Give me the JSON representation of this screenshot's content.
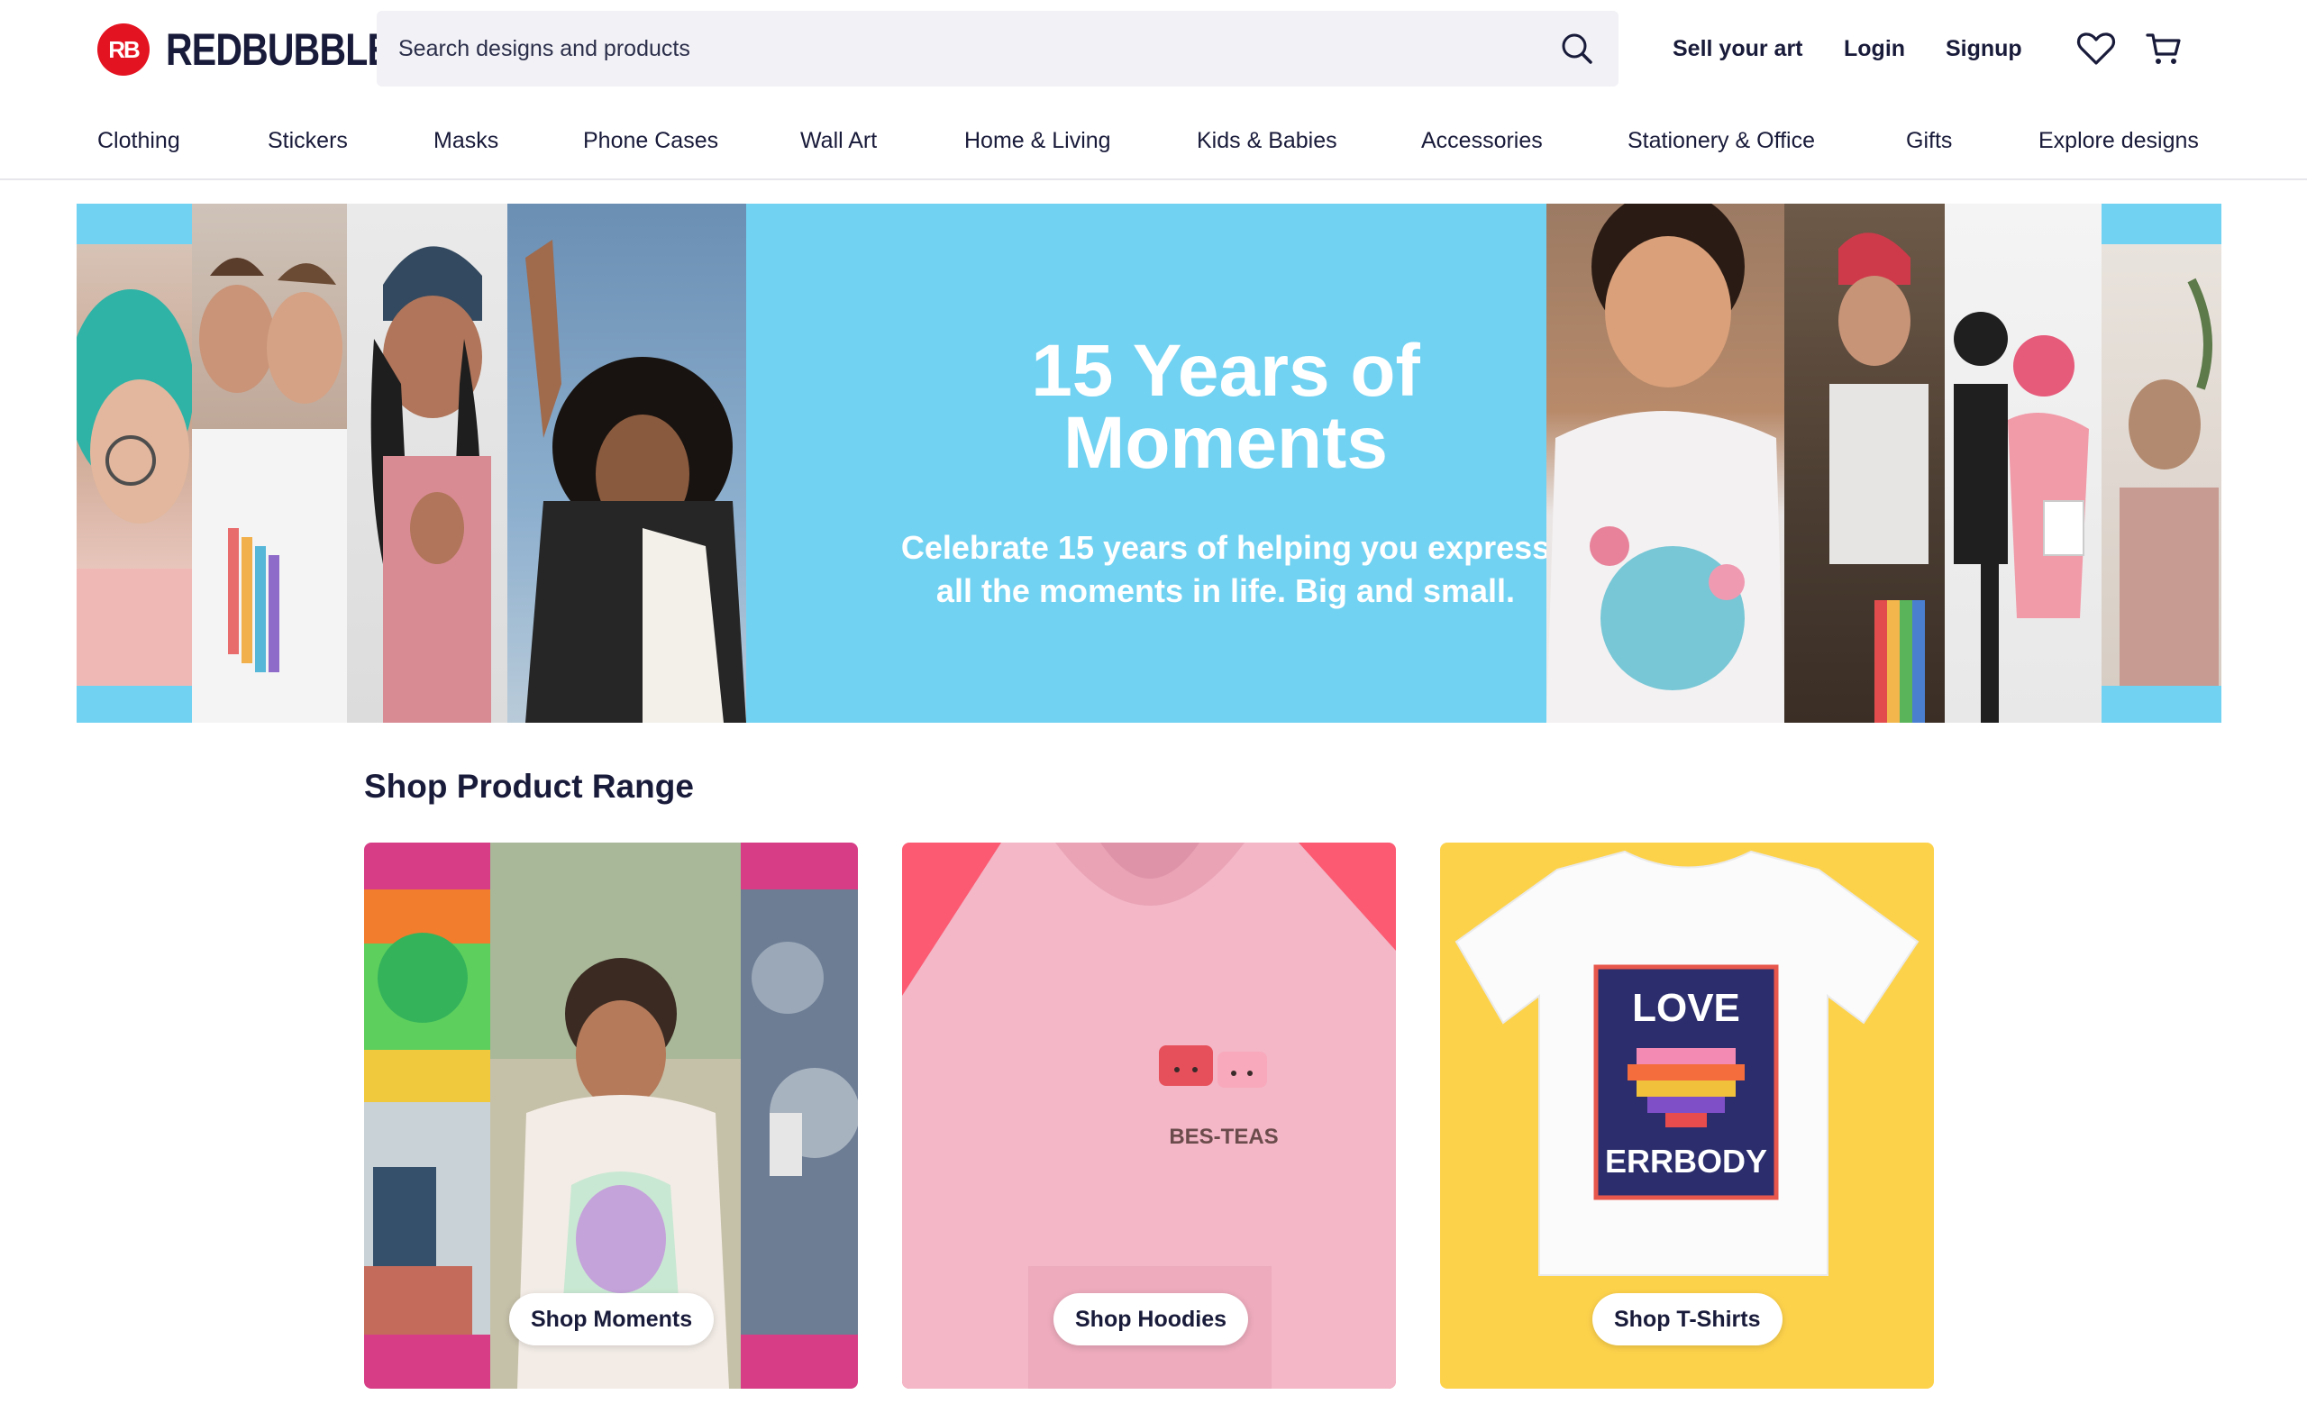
{
  "brand": {
    "name": "REDBUBBLE",
    "mark": "RB",
    "color": "#e41321"
  },
  "search": {
    "placeholder": "Search designs and products",
    "icon": "search-icon"
  },
  "header_links": {
    "sell": "Sell your art",
    "login": "Login",
    "signup": "Signup"
  },
  "header_icons": [
    "heart-icon",
    "cart-icon"
  ],
  "nav": [
    "Clothing",
    "Stickers",
    "Masks",
    "Phone Cases",
    "Wall Art",
    "Home & Living",
    "Kids & Babies",
    "Accessories",
    "Stationery & Office",
    "Gifts",
    "Explore designs"
  ],
  "hero": {
    "title_line1": "15 Years of",
    "title_line2": "Moments",
    "subtitle_line1": "Celebrate 15 years of helping you express",
    "subtitle_line2": "all the moments in life. Big and small.",
    "background": "#72d2f2"
  },
  "section": {
    "title": "Shop Product Range"
  },
  "cards": [
    {
      "button": "Shop Moments",
      "background": "#d63d86"
    },
    {
      "button": "Shop Hoodies",
      "background": "#fb5a72",
      "design_text": "BES-TEAS"
    },
    {
      "button": "Shop T-Shirts",
      "background": "#fdd24b",
      "design_text_top": "LOVE",
      "design_text_bottom": "ERRBODY"
    }
  ]
}
